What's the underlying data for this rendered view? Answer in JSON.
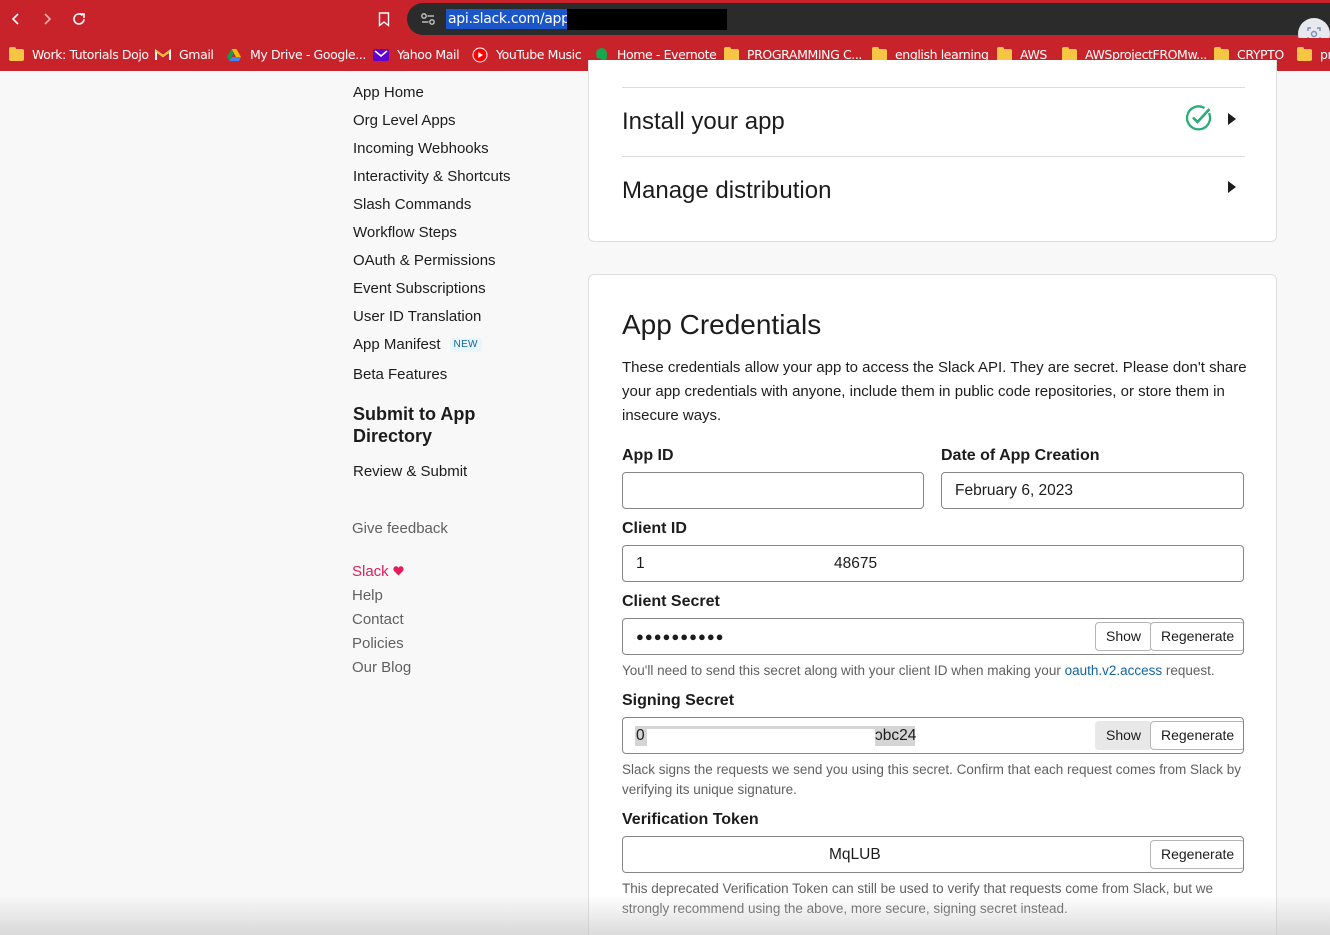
{
  "browser": {
    "url": "api.slack.com/apps/",
    "bookmarks": [
      {
        "label": "Work: Tutorials Dojo",
        "icon": "folder-icon"
      },
      {
        "label": "Gmail",
        "icon": "gmail-icon"
      },
      {
        "label": "My Drive - Google...",
        "icon": "google-drive-icon"
      },
      {
        "label": "Yahoo Mail",
        "icon": "yahoo-mail-icon"
      },
      {
        "label": "YouTube Music",
        "icon": "youtube-music-icon"
      },
      {
        "label": "Home - Evernote",
        "icon": "evernote-icon"
      },
      {
        "label": "PROGRAMMING C...",
        "icon": "folder-icon"
      },
      {
        "label": "english learning",
        "icon": "folder-icon"
      },
      {
        "label": "AWS",
        "icon": "folder-icon"
      },
      {
        "label": "AWSprojectFROMw...",
        "icon": "folder-icon"
      },
      {
        "label": "CRYPTO",
        "icon": "folder-icon"
      },
      {
        "label": "pr",
        "icon": "folder-icon"
      }
    ]
  },
  "sidebar": {
    "items": [
      {
        "label": "App Home"
      },
      {
        "label": "Org Level Apps"
      },
      {
        "label": "Incoming Webhooks"
      },
      {
        "label": "Interactivity & Shortcuts"
      },
      {
        "label": "Slash Commands"
      },
      {
        "label": "Workflow Steps"
      },
      {
        "label": "OAuth & Permissions"
      },
      {
        "label": "Event Subscriptions"
      },
      {
        "label": "User ID Translation"
      },
      {
        "label": "App Manifest",
        "badge": "NEW"
      },
      {
        "label": "Beta Features"
      }
    ],
    "submit_heading": "Submit to App Directory",
    "review_submit": "Review & Submit",
    "feedback": "Give feedback",
    "footer": {
      "slack": "Slack",
      "help": "Help",
      "contact": "Contact",
      "policies": "Policies",
      "blog": "Our Blog"
    }
  },
  "steps": {
    "install": "Install your app",
    "distribution": "Manage distribution"
  },
  "credentials": {
    "title": "App Credentials",
    "description": "These credentials allow your app to access the Slack API. They are secret. Please don't share your app credentials with anyone, include them in public code repositories, or store them in insecure ways.",
    "app_id_label": "App ID",
    "app_id_value": "",
    "date_label": "Date of App Creation",
    "date_value": "February 6, 2023",
    "client_id_label": "Client ID",
    "client_id_start": "1",
    "client_id_end": "48675",
    "client_secret_label": "Client Secret",
    "client_secret_value": "●●●●●●●●●●",
    "client_secret_hint_pre": "You'll need to send this secret along with your client ID when making your ",
    "client_secret_hint_link": "oauth.v2.access",
    "client_secret_hint_post": " request.",
    "signing_secret_label": "Signing Secret",
    "signing_secret_start": "0",
    "signing_secret_end": "ɔbc24",
    "signing_secret_hint": "Slack signs the requests we send you using this secret. Confirm that each request comes from Slack by verifying its unique signature.",
    "verification_label": "Verification Token",
    "verification_end": "MqLUB",
    "verification_hint": "This deprecated Verification Token can still be used to verify that requests come from Slack, but we strongly recommend using the above, more secure, signing secret instead.",
    "show_label": "Show",
    "regenerate_label": "Regenerate"
  },
  "colors": {
    "browser_accent": "#c8222a",
    "success_check": "#2bac76",
    "link": "#1264a3",
    "slack_heart": "#e01e5a"
  }
}
